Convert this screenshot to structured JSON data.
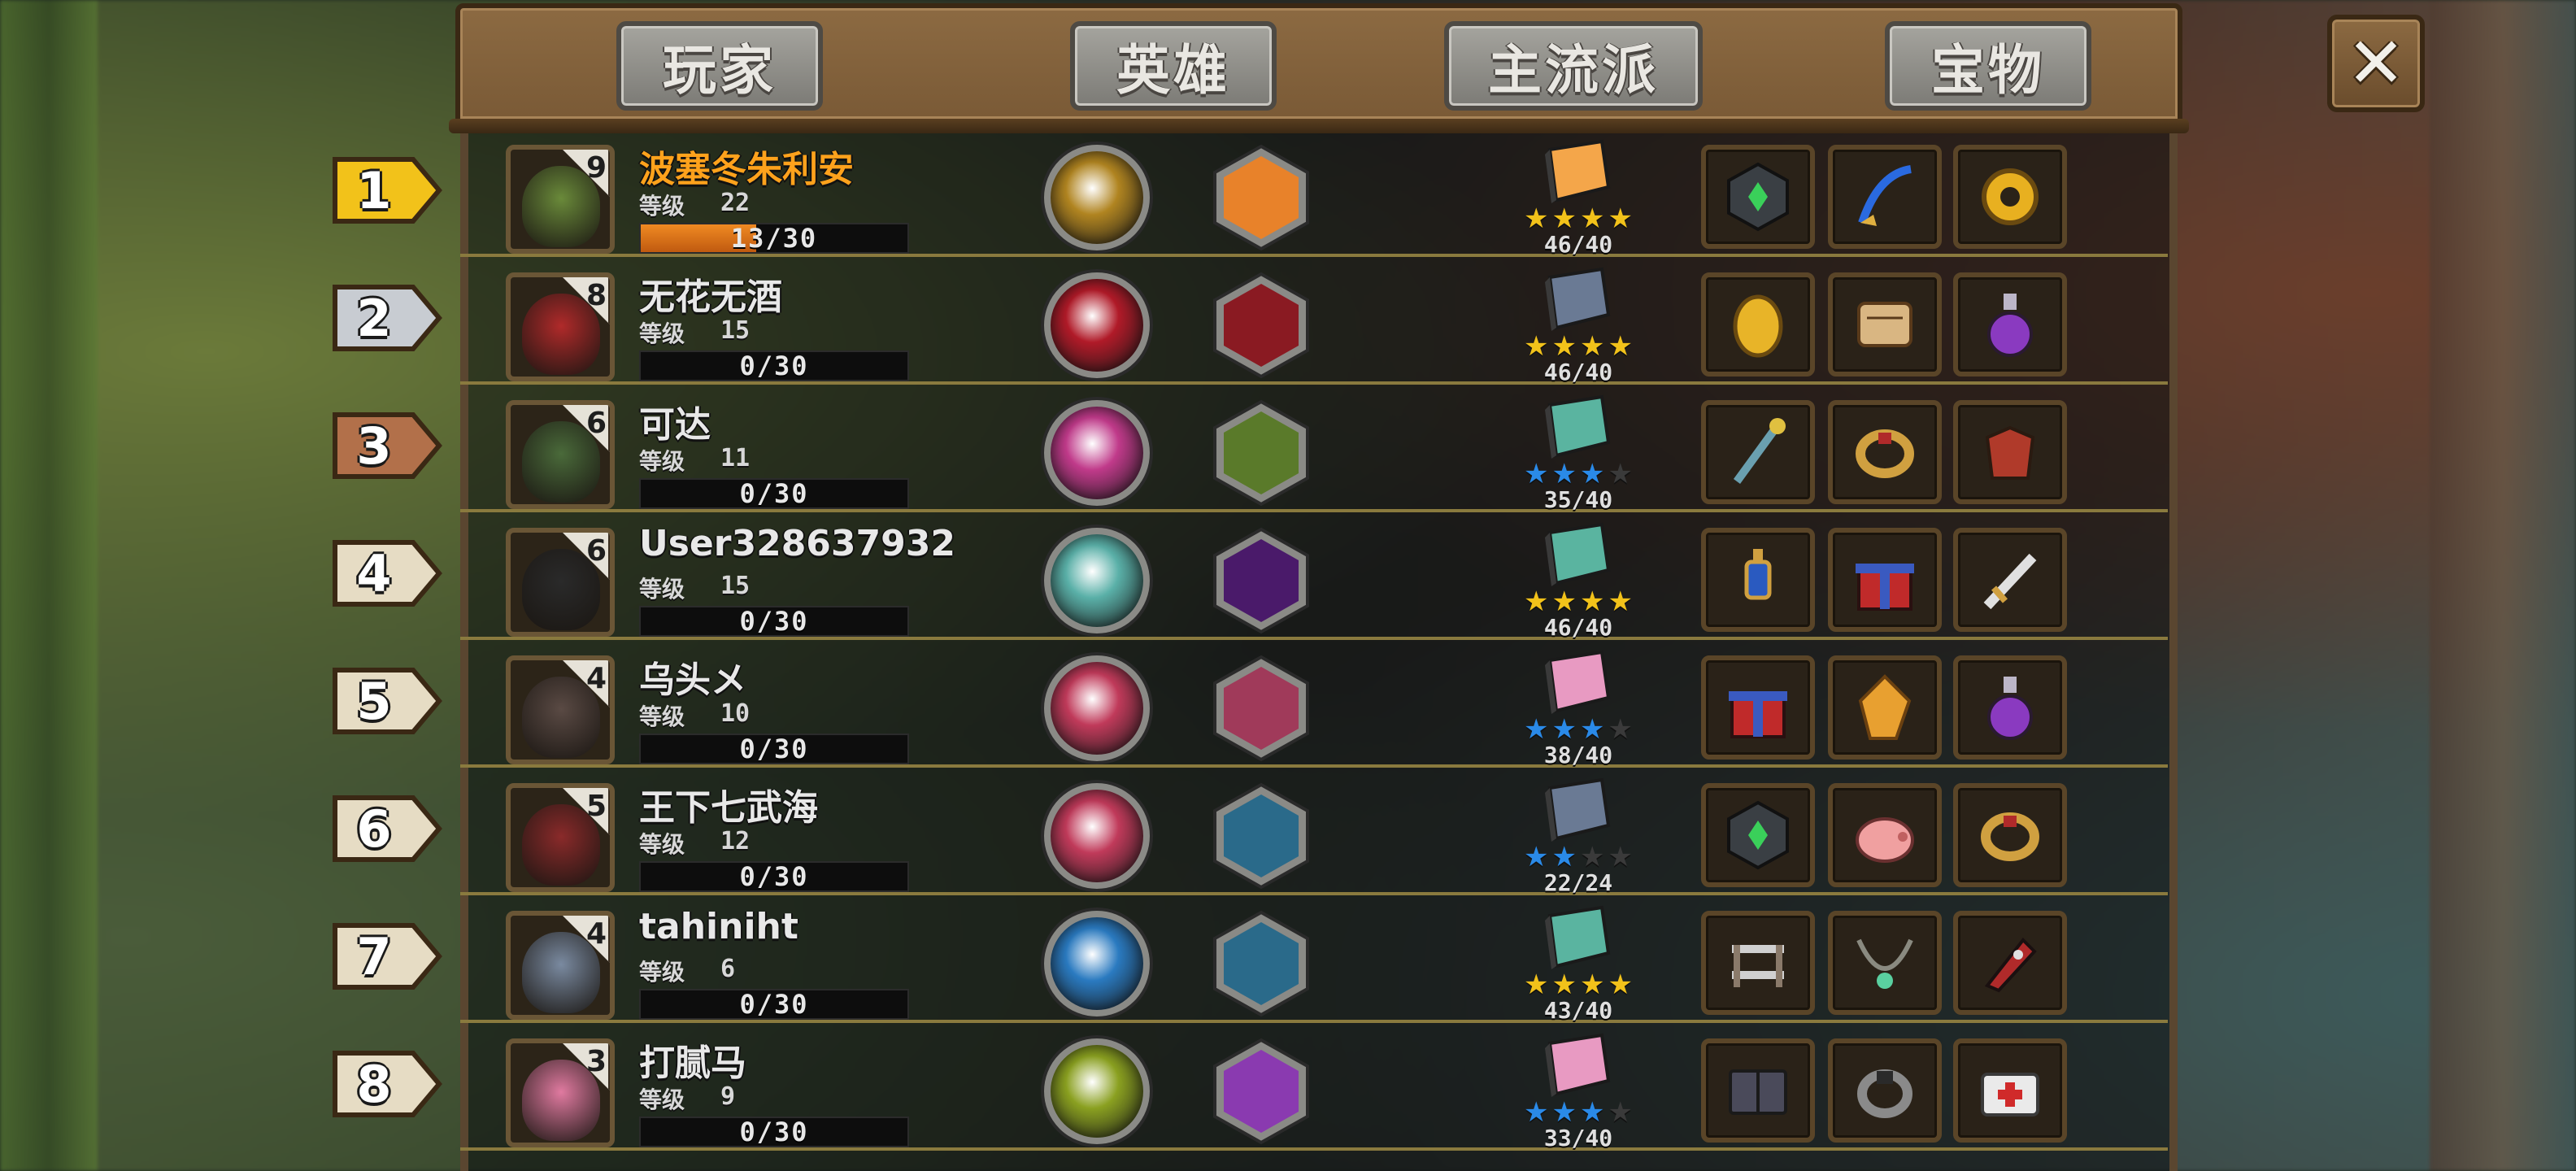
{
  "tabs": {
    "player": "玩家",
    "hero": "英雄",
    "mainstream": "主流派",
    "treasure": "宝物"
  },
  "close_label": "✕",
  "level_label": "等级",
  "rows": [
    {
      "rank": "1",
      "name": "波塞冬朱利安",
      "level": "22",
      "hero_level": "9",
      "progress": "13/30",
      "progress_fraction": 0.433,
      "score": "46/40",
      "stars": 4,
      "max_stars": 4,
      "star_color": "#f2c21a",
      "book_color": "#f4a64a",
      "orb_color": "#b08420",
      "hex_color": "#e8822a",
      "rank_color": "#f2c21a",
      "avatar_color": "#6a8a3a",
      "items": [
        "dark-gem",
        "blue-whip",
        "gold-gear"
      ]
    },
    {
      "rank": "2",
      "name": "无花无酒",
      "level": "15",
      "hero_level": "8",
      "progress": "0/30",
      "progress_fraction": 0,
      "score": "46/40",
      "stars": 4,
      "max_stars": 4,
      "star_color": "#f2c21a",
      "book_color": "#6a7a94",
      "orb_color": "#b01a28",
      "hex_color": "#8a1a22",
      "rank_color": "#c8ccd2",
      "avatar_color": "#b02a2a",
      "items": [
        "gold-coin",
        "scroll",
        "potion"
      ]
    },
    {
      "rank": "3",
      "name": "可达",
      "level": "11",
      "hero_level": "6",
      "progress": "0/30",
      "progress_fraction": 0,
      "score": "35/40",
      "stars": 3,
      "max_stars": 4,
      "star_color": "#2a8ae8",
      "book_color": "#5ab4a0",
      "orb_color": "#c03a8a",
      "hex_color": "#5a7a2a",
      "rank_color": "#b2704a",
      "avatar_color": "#4a6a3a",
      "items": [
        "staff",
        "bracelet",
        "armor"
      ]
    },
    {
      "rank": "4",
      "name": "User328637932",
      "level": "15",
      "hero_level": "6",
      "progress": "0/30",
      "progress_fraction": 0,
      "score": "46/40",
      "stars": 4,
      "max_stars": 4,
      "star_color": "#f2c21a",
      "book_color": "#5ab4a0",
      "orb_color": "#5ab0a8",
      "hex_color": "#4a1a6a",
      "rank_color": "#e6dcc4",
      "avatar_color": "#2a2a2a",
      "items": [
        "lantern",
        "gift-box",
        "sword"
      ]
    },
    {
      "rank": "5",
      "name": "乌头メ",
      "level": "10",
      "hero_level": "4",
      "progress": "0/30",
      "progress_fraction": 0,
      "score": "38/40",
      "stars": 3,
      "max_stars": 4,
      "star_color": "#2a8ae8",
      "book_color": "#e89ac2",
      "orb_color": "#c03a5a",
      "hex_color": "#a03a5a",
      "rank_color": "#e6dcc4",
      "avatar_color": "#5a4a44",
      "items": [
        "gift-box",
        "amber-crystal",
        "potion"
      ]
    },
    {
      "rank": "6",
      "name": "王下七武海",
      "level": "12",
      "hero_level": "5",
      "progress": "0/30",
      "progress_fraction": 0,
      "score": "22/24",
      "stars": 2,
      "max_stars": 4,
      "star_color": "#2a8ae8",
      "book_color": "#6a7a94",
      "orb_color": "#c03a5a",
      "hex_color": "#2a6a8a",
      "rank_color": "#e6dcc4",
      "avatar_color": "#8a2a2a",
      "items": [
        "dark-gem",
        "piggy-bank",
        "bracelet"
      ]
    },
    {
      "rank": "7",
      "name": "tahiniht",
      "level": "6",
      "hero_level": "4",
      "progress": "0/30",
      "progress_fraction": 0,
      "score": "43/40",
      "stars": 4,
      "max_stars": 4,
      "star_color": "#f2c21a",
      "book_color": "#5ab4a0",
      "orb_color": "#2a7ac0",
      "hex_color": "#2a6a8a",
      "rank_color": "#e6dcc4",
      "avatar_color": "#7a8aa0",
      "items": [
        "shelf",
        "necklace",
        "rocket"
      ]
    },
    {
      "rank": "8",
      "name": "打腻马",
      "level": "9",
      "hero_level": "3",
      "progress": "0/30",
      "progress_fraction": 0,
      "score": "33/40",
      "stars": 3,
      "max_stars": 4,
      "star_color": "#2a8ae8",
      "book_color": "#e89ac2",
      "orb_color": "#8aa020",
      "hex_color": "#8a3ab0",
      "rank_color": "#e6dcc4",
      "avatar_color": "#e07aa0",
      "items": [
        "spellbook",
        "ring",
        "first-aid-kit"
      ]
    }
  ]
}
